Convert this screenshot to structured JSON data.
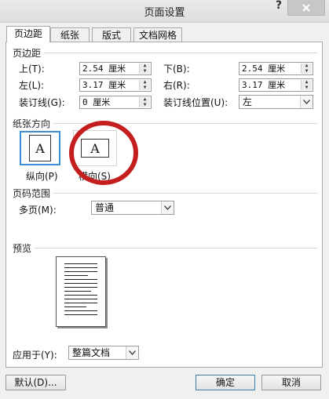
{
  "window": {
    "title": "页面设置",
    "help": "?"
  },
  "tabs": [
    {
      "label": "页边距",
      "active": true
    },
    {
      "label": "纸张"
    },
    {
      "label": "版式"
    },
    {
      "label": "文档网格"
    }
  ],
  "margins": {
    "section_title": "页边距",
    "top": {
      "label": "上(T):",
      "value": "2.54 厘米"
    },
    "bottom": {
      "label": "下(B):",
      "value": "2.54 厘米"
    },
    "left": {
      "label": "左(L):",
      "value": "3.17 厘米"
    },
    "right": {
      "label": "右(R):",
      "value": "3.17 厘米"
    },
    "gutter": {
      "label": "装订线(G):",
      "value": "0 厘米"
    },
    "gutter_pos": {
      "label": "装订线位置(U):",
      "value": "左"
    }
  },
  "orientation": {
    "section_title": "纸张方向",
    "glyph": "A",
    "portrait_label": "纵向(P)",
    "landscape_label": "横向(S)"
  },
  "pages": {
    "section_title": "页码范围",
    "multiple_label": "多页(M):",
    "multiple_value": "普通"
  },
  "preview": {
    "section_title": "预览"
  },
  "apply": {
    "label": "应用于(Y):",
    "value": "整篇文档"
  },
  "buttons": {
    "default": "默认(D)...",
    "ok": "确定",
    "cancel": "取消"
  },
  "colors": {
    "highlight_circle": "#c41e1e",
    "selected_border": "#3c8fd6"
  }
}
